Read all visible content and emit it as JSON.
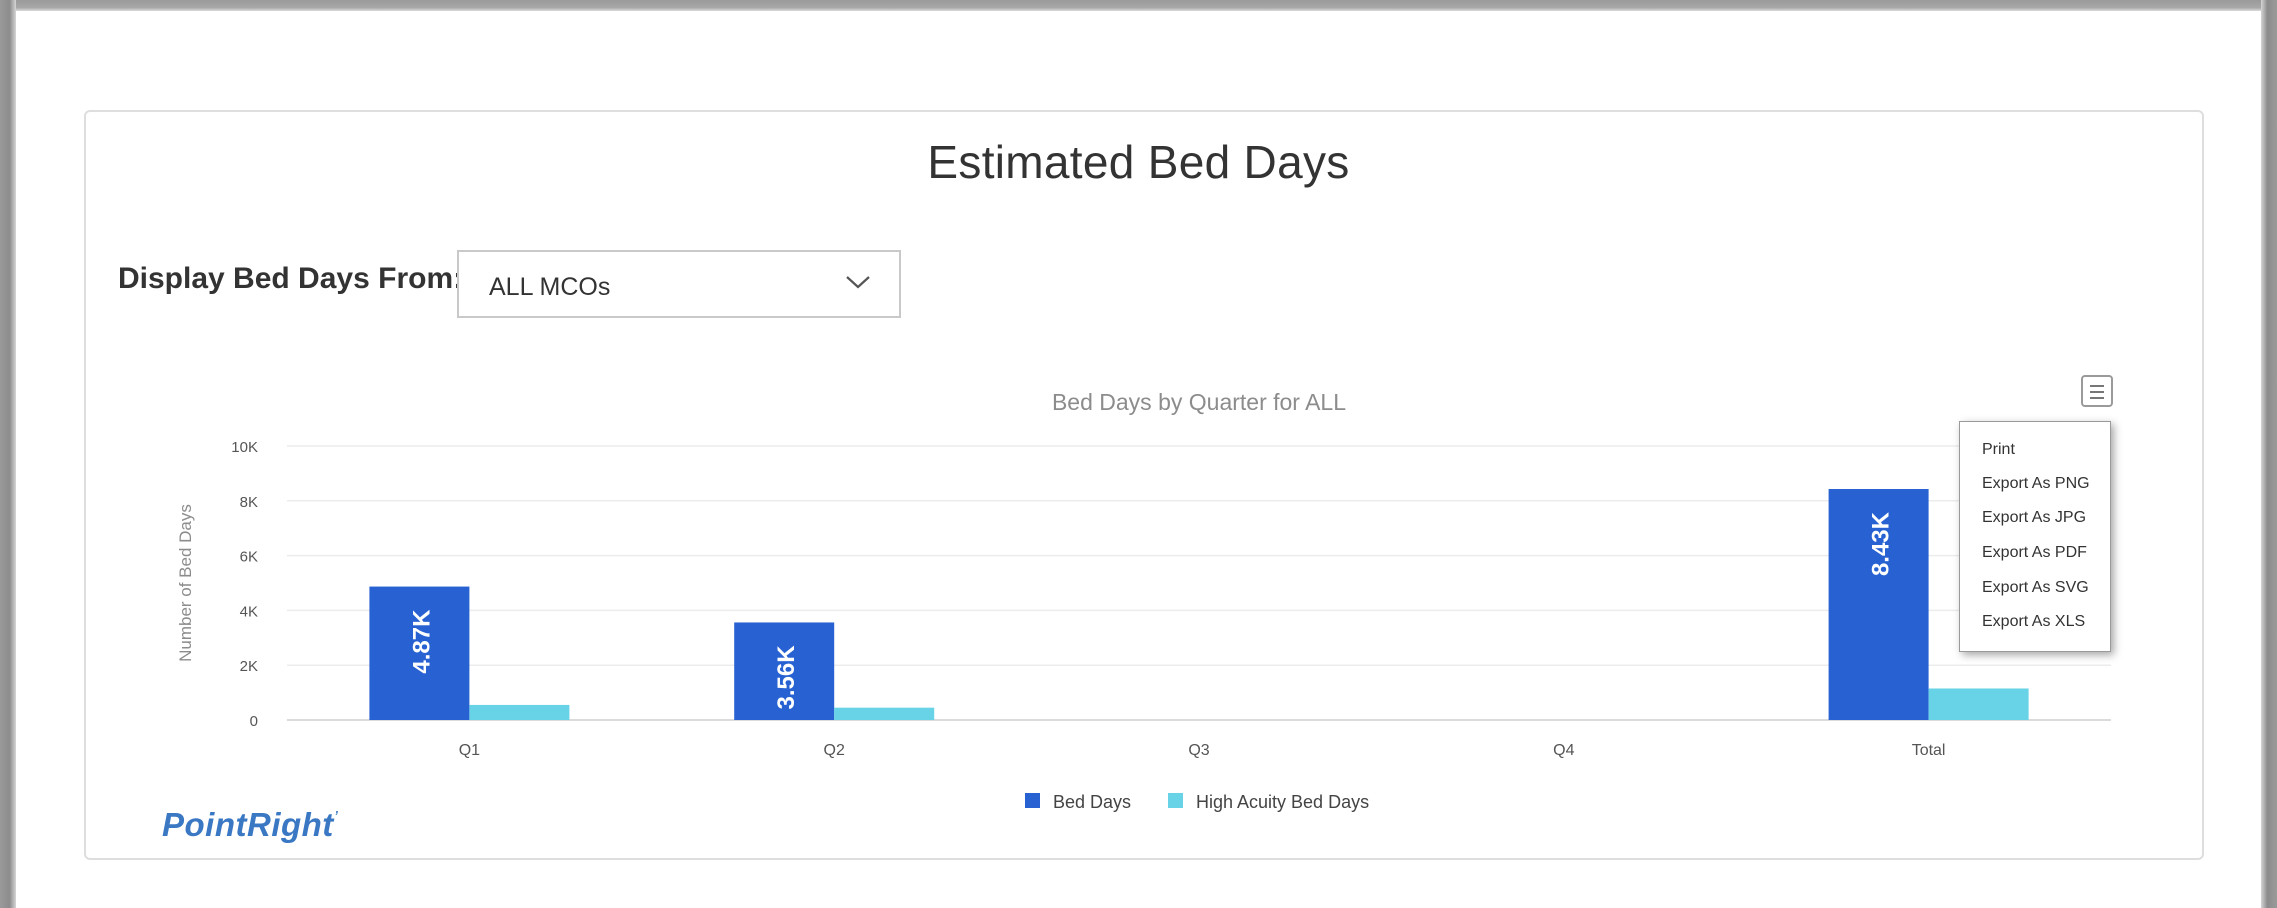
{
  "page": {
    "title": "Estimated Bed Days",
    "filter": {
      "label": "Display Bed Days From:",
      "selected": "ALL MCOs"
    },
    "logo_text": "PointRight",
    "export_menu": [
      "Print",
      "Export As PNG",
      "Export As JPG",
      "Export As PDF",
      "Export As SVG",
      "Export As XLS"
    ]
  },
  "chart_data": {
    "type": "bar",
    "title": "Bed Days by Quarter for ALL",
    "ylabel": "Number of Bed Days",
    "xlabel": "",
    "categories": [
      "Q1",
      "Q2",
      "Q3",
      "Q4",
      "Total"
    ],
    "series": [
      {
        "name": "Bed Days",
        "values": [
          4870,
          3560,
          0,
          0,
          8430
        ],
        "labels": [
          "4.87K",
          "3.56K",
          "",
          "",
          "8.43K"
        ],
        "color": "#2862d2"
      },
      {
        "name": "High Acuity Bed Days",
        "values": [
          550,
          450,
          0,
          0,
          1150
        ],
        "labels": [
          "",
          "",
          "",
          "",
          ""
        ],
        "color": "#68d2e6"
      }
    ],
    "ylim": [
      0,
      10000
    ],
    "yticks": [
      0,
      2000,
      4000,
      6000,
      8000,
      10000
    ],
    "ytick_labels": [
      "0",
      "2K",
      "4K",
      "6K",
      "8K",
      "10K"
    ],
    "grid": true,
    "legend": "bottom-center"
  }
}
